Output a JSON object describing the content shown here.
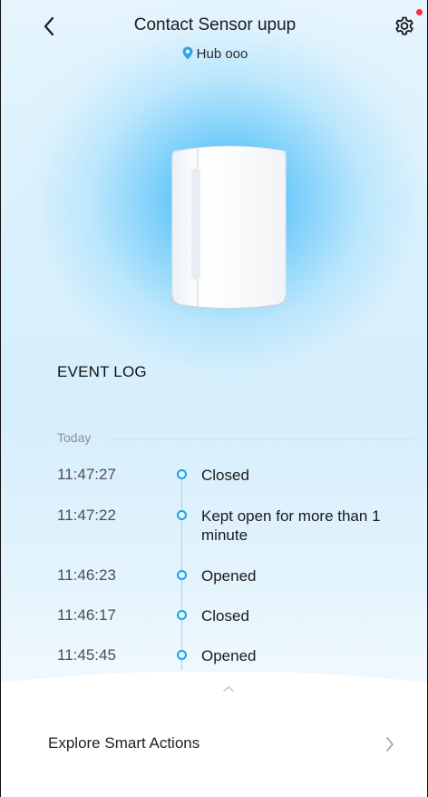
{
  "header": {
    "title": "Contact Sensor upup",
    "location": "Hub ooo",
    "back_icon": "back-chevron-icon",
    "settings_icon": "gear-icon",
    "notification_dot_color": "#ff2d3c"
  },
  "event_log": {
    "title": "EVENT LOG",
    "day": "Today",
    "events": [
      {
        "time": "11:47:27",
        "text": "Closed"
      },
      {
        "time": "11:47:22",
        "text": "Kept open for more than 1 minute"
      },
      {
        "time": "11:46:23",
        "text": "Opened"
      },
      {
        "time": "11:46:17",
        "text": "Closed"
      },
      {
        "time": "11:45:45",
        "text": "Opened"
      }
    ]
  },
  "bottom_sheet": {
    "explore_label": "Explore Smart Actions",
    "chevron_icon": "chevron-right-icon",
    "handle_icon": "chevron-up-icon"
  },
  "colors": {
    "accent": "#1aa3e8",
    "glow": "#10aafa"
  }
}
